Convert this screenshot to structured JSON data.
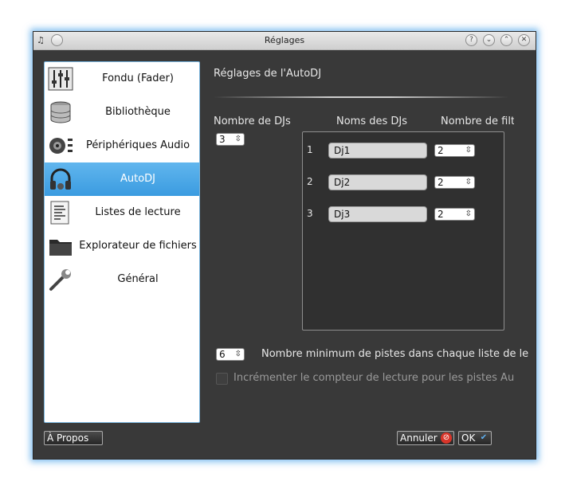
{
  "window": {
    "title": "Réglages",
    "title_buttons": [
      "?",
      "⌄",
      "⌃",
      "✕"
    ]
  },
  "sidebar": {
    "items": [
      {
        "label": "Fondu (Fader)",
        "icon": "fader-sliders-icon"
      },
      {
        "label": "Bibliothèque",
        "icon": "database-icon"
      },
      {
        "label": "Périphériques Audio",
        "icon": "speaker-icon"
      },
      {
        "label": "AutoDJ",
        "icon": "headphones-icon",
        "active": true
      },
      {
        "label": "Listes de lecture",
        "icon": "playlist-document-icon"
      },
      {
        "label": "Explorateur de fichiers",
        "icon": "folder-icon"
      },
      {
        "label": "Général",
        "icon": "wrench-icon"
      }
    ]
  },
  "main": {
    "heading": "Réglages de l'AutoDJ",
    "col_num_djs": "Nombre de DJs",
    "col_dj_names": "Noms des DJs",
    "col_num_filters": "Nombre de filtr",
    "num_djs_value": "3",
    "djs": [
      {
        "num": "1",
        "name": "Dj1",
        "filters": "2"
      },
      {
        "num": "2",
        "name": "Dj2",
        "filters": "2"
      },
      {
        "num": "3",
        "name": "Dj3",
        "filters": "2"
      }
    ],
    "min_tracks_value": "6",
    "min_tracks_label": "Nombre minimum de pistes dans chaque liste de le",
    "increment_label": "Incrémenter le compteur de lecture pour les pistes Au",
    "increment_checked": false
  },
  "footer": {
    "about": "À Propos",
    "cancel": "Annuler",
    "ok": "OK"
  },
  "colors": {
    "accent": "#3a9be0",
    "window_bg": "#393939",
    "glow": "#5aaaeb"
  }
}
